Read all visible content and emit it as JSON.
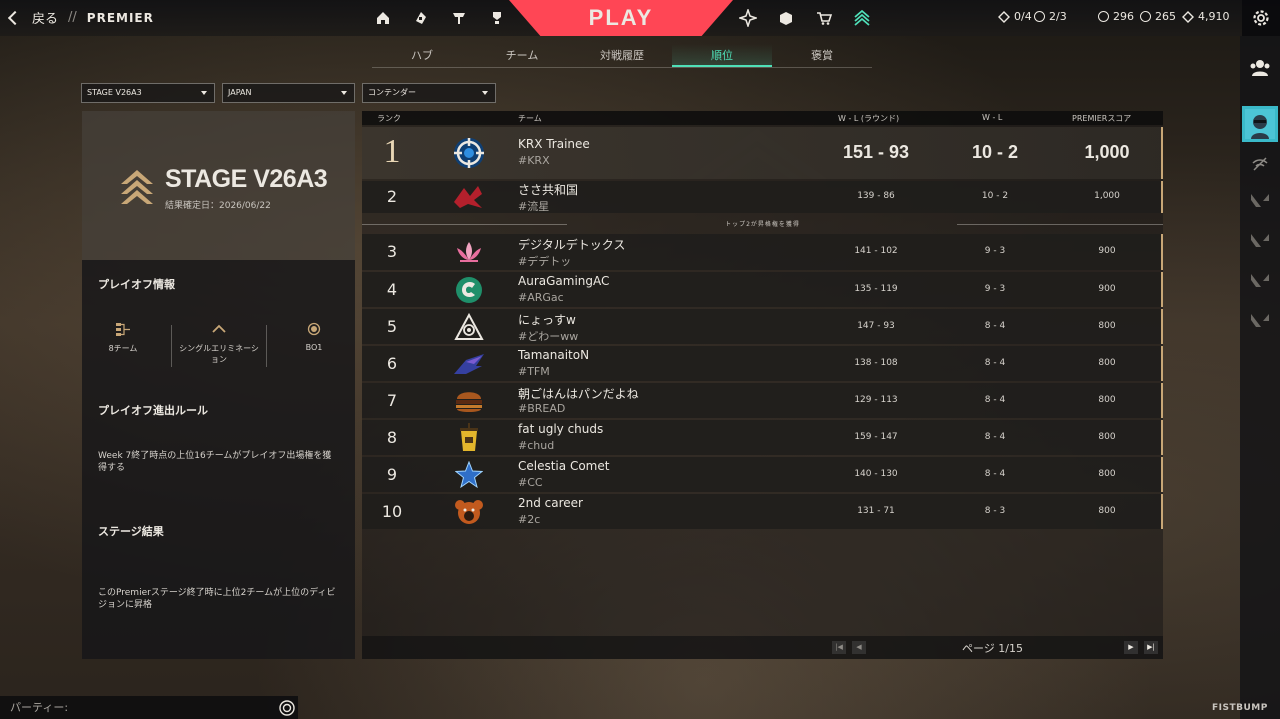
{
  "topbar": {
    "back_label": "戻る",
    "separator": "//",
    "section_label": "PREMIER",
    "play_label": "PLAY",
    "missions_daily": "0/4",
    "missions_weekly": "2/3",
    "vp": "296",
    "radianite": "265",
    "kingdom_credits": "4,910"
  },
  "tabs": [
    "ハブ",
    "チーム",
    "対戦履歴",
    "順位",
    "褒賞"
  ],
  "active_tab": "順位",
  "filters": {
    "stage": "STAGE V26A3",
    "region": "JAPAN",
    "division": "コンテンダー"
  },
  "stage": {
    "title": "STAGE V26A3",
    "results_date": "結果確定日：2026/06/22"
  },
  "playoff": {
    "info_heading": "プレイオフ情報",
    "teams": "8チーム",
    "format": "シングルエリミネーション",
    "series": "BO1",
    "rules_heading": "プレイオフ進出ルール",
    "rules_text": "Week 7終了時点の上位16チームがプレイオフ出場権を獲得する",
    "results_heading": "ステージ結果",
    "results_text": "このPremierステージ終了時に上位2チームが上位のディビジョンに昇格"
  },
  "table": {
    "headers": {
      "rank": "ランク",
      "team": "チーム",
      "wl_rounds": "W - L (ラウンド)",
      "wl": "W - L",
      "score": "PREMIERスコア"
    },
    "promotion_text": "トップ2が昇格権を獲得",
    "rows": [
      {
        "rank": "1",
        "name": "KRX Trainee",
        "tag": "#KRX",
        "rounds": "151 - 93",
        "wl": "10 - 2",
        "score": "1,000",
        "logo": "crosshair-logo"
      },
      {
        "rank": "2",
        "name": "ささ共和国",
        "tag": "#流星",
        "rounds": "139 - 86",
        "wl": "10 - 2",
        "score": "1,000",
        "logo": "red-bird-logo"
      },
      {
        "rank": "3",
        "name": "デジタルデトックス",
        "tag": "#デデトッ",
        "rounds": "141 - 102",
        "wl": "9 - 3",
        "score": "900",
        "logo": "lotus-logo"
      },
      {
        "rank": "4",
        "name": "AuraGamingAC",
        "tag": "#ARGac",
        "rounds": "135 - 119",
        "wl": "9 - 3",
        "score": "900",
        "logo": "green-swirl-logo"
      },
      {
        "rank": "5",
        "name": "にょっすw",
        "tag": "#どわーww",
        "rounds": "147 - 93",
        "wl": "8 - 4",
        "score": "800",
        "logo": "triangle-eye-logo"
      },
      {
        "rank": "6",
        "name": "TamanaitoN",
        "tag": "#TFM",
        "rounds": "138 - 108",
        "wl": "8 - 4",
        "score": "800",
        "logo": "wing-logo"
      },
      {
        "rank": "7",
        "name": "朝ごはんはパンだよね",
        "tag": "#BREAD",
        "rounds": "129 - 113",
        "wl": "8 - 4",
        "score": "800",
        "logo": "burger-logo"
      },
      {
        "rank": "8",
        "name": "fat ugly chuds",
        "tag": "#chud",
        "rounds": "159 - 147",
        "wl": "8 - 4",
        "score": "800",
        "logo": "drink-logo"
      },
      {
        "rank": "9",
        "name": "Celestia Comet",
        "tag": "#CC",
        "rounds": "140 - 130",
        "wl": "8 - 4",
        "score": "800",
        "logo": "star-logo"
      },
      {
        "rank": "10",
        "name": "2nd career",
        "tag": "#2c",
        "rounds": "131 - 71",
        "wl": "8 - 3",
        "score": "800",
        "logo": "bear-logo"
      }
    ],
    "page_label": "ページ 1/15"
  },
  "party_label": "パーティー:",
  "brand": "FISTBUMP",
  "colors": {
    "accent_red": "#ff4655",
    "accent_teal": "#4fe0b8",
    "gold": "#c8a777"
  }
}
